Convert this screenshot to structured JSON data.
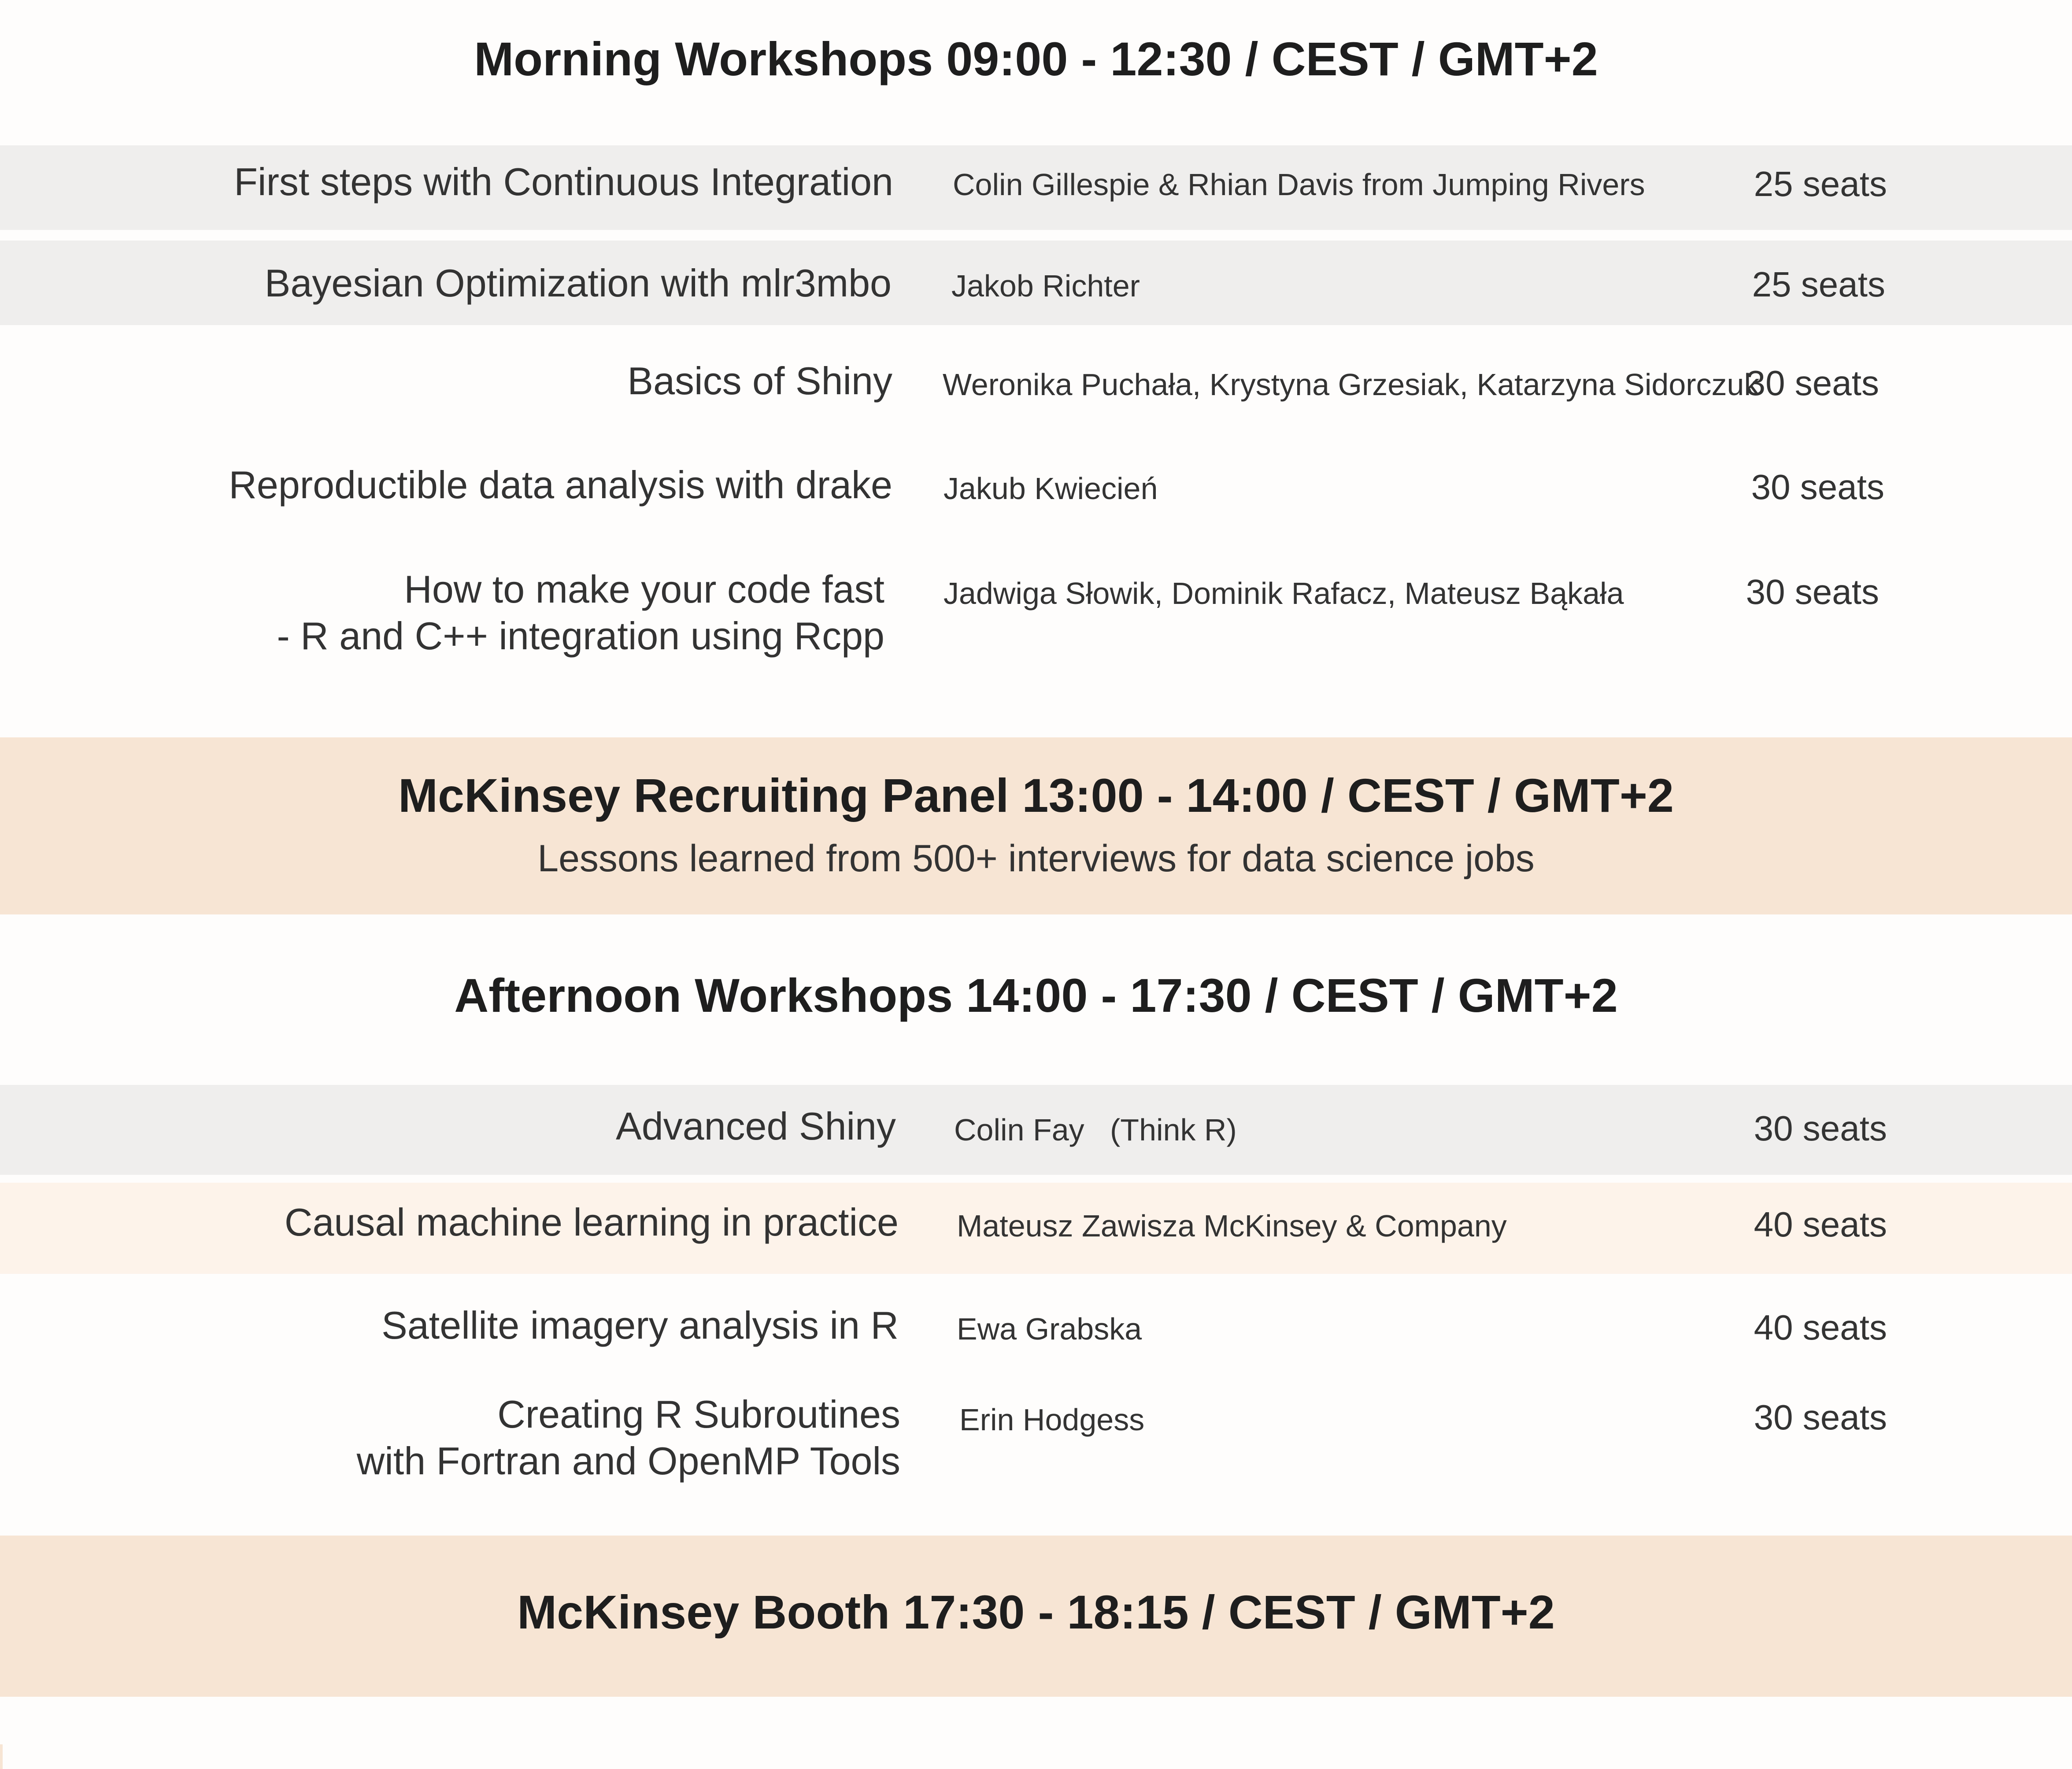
{
  "morning": {
    "heading": "Morning Workshops 09:00 - 12:30 / CEST / GMT+2",
    "rows": [
      {
        "title_lines": [
          "First steps with Continuous Integration"
        ],
        "speaker": "Colin Gillespie & Rhian Davis from Jumping Rivers",
        "seats": "25 seats"
      },
      {
        "title_lines": [
          "Bayesian Optimization with mlr3mbo"
        ],
        "speaker": "Jakob Richter",
        "seats": "25 seats"
      },
      {
        "title_lines": [
          "Basics of Shiny"
        ],
        "speaker": "Weronika Puchała, Krystyna Grzesiak, Katarzyna Sidorczuk",
        "seats": "30 seats"
      },
      {
        "title_lines": [
          "Reproductible data analysis with drake"
        ],
        "speaker": "Jakub Kwiecień",
        "seats": "30 seats"
      },
      {
        "title_lines": [
          "How to make your code fast",
          "- R and C++ integration using Rcpp"
        ],
        "speaker": "Jadwiga Słowik, Dominik Rafacz, Mateusz Bąkała",
        "seats": "30 seats"
      }
    ]
  },
  "recruiting_panel": {
    "heading": "McKinsey Recruiting Panel 13:00 - 14:00 / CEST / GMT+2",
    "subheading": "Lessons learned from 500+ interviews for data science jobs"
  },
  "afternoon": {
    "heading": "Afternoon Workshops 14:00 - 17:30 / CEST / GMT+2",
    "rows": [
      {
        "title_lines": [
          "Advanced Shiny"
        ],
        "speaker": "Colin Fay   (Think R)",
        "seats": "30 seats"
      },
      {
        "title_lines": [
          "Causal machine learning in practice"
        ],
        "speaker": "Mateusz Zawisza McKinsey & Company",
        "seats": "40 seats"
      },
      {
        "title_lines": [
          "Satellite imagery analysis in R"
        ],
        "speaker": "Ewa Grabska",
        "seats": "40 seats"
      },
      {
        "title_lines": [
          "Creating R Subroutines",
          "with Fortran and OpenMP Tools"
        ],
        "speaker": "Erin Hodgess",
        "seats": "30 seats"
      }
    ]
  },
  "booth": {
    "heading": "McKinsey Booth 17:30 - 18:15 / CEST / GMT+2"
  },
  "colors": {
    "grey_band": "#efeeed",
    "peach_band": "#f7e5d4",
    "light_peach_band": "#fdf3ea",
    "heading_text": "#1e1e1e",
    "body_text": "#333333"
  }
}
